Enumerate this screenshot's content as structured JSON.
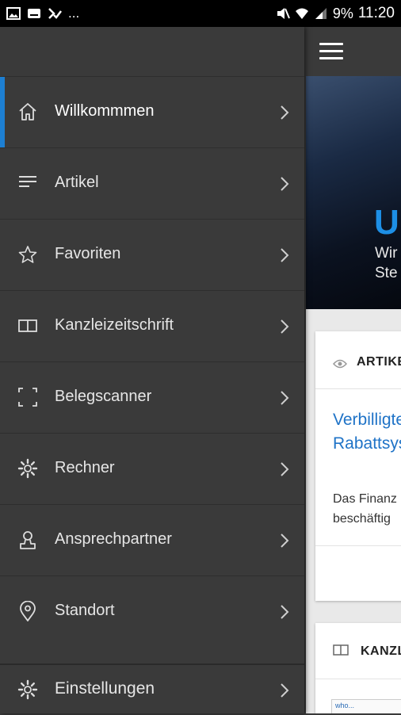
{
  "status_bar": {
    "left_icons": [
      "image-icon",
      "keyboard-icon",
      "checklist-icon"
    ],
    "overflow": "...",
    "battery": "9%",
    "time": "11:20"
  },
  "nav": {
    "items": [
      {
        "label": "Willkommmen",
        "icon": "home-icon",
        "active": true
      },
      {
        "label": "Artikel",
        "icon": "list-icon"
      },
      {
        "label": "Favoriten",
        "icon": "star-icon"
      },
      {
        "label": "Kanzleizeitschrift",
        "icon": "book-icon"
      },
      {
        "label": "Belegscanner",
        "icon": "scan-icon"
      },
      {
        "label": "Rechner",
        "icon": "gear-icon"
      },
      {
        "label": "Ansprechpartner",
        "icon": "person-icon"
      },
      {
        "label": "Standort",
        "icon": "location-pin-icon"
      }
    ],
    "settings": {
      "label": "Einstellungen",
      "icon": "gear-icon"
    },
    "accent_color": "#1d7fd2"
  },
  "background_app": {
    "hero": {
      "logo": "U",
      "line1": "Wir",
      "line2": "Ste"
    },
    "card1": {
      "category": "ARTIKE",
      "title_line1": "Verbilligte",
      "title_line2": "Rabattsys",
      "body_line1": "Das Finanz",
      "body_line2": "beschäftig"
    },
    "card2": {
      "category": "KANZL",
      "thumb_text": "who..."
    },
    "link_color": "#1f73c7",
    "logo_color": "#1d8fe6"
  }
}
